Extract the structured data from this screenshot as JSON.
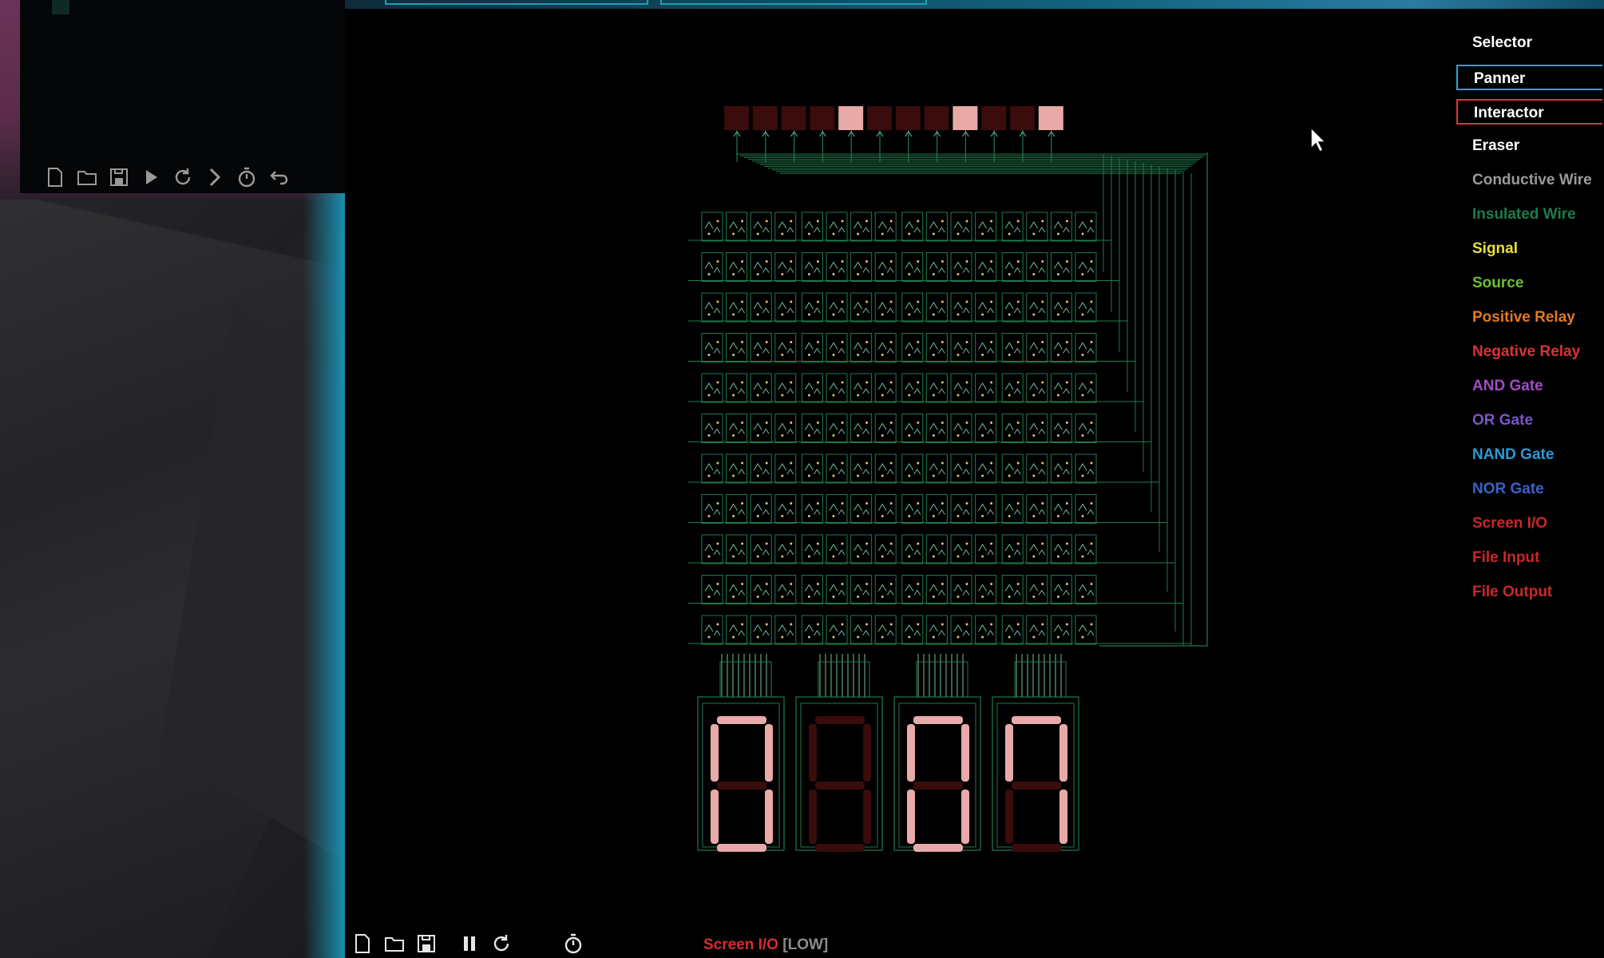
{
  "app": {
    "tools_title": "Tools",
    "tools": [
      {
        "label": "Selector",
        "color": "#ffffff",
        "state": "normal"
      },
      {
        "label": "Panner",
        "color": "#ffffff",
        "state": "hovered"
      },
      {
        "label": "Interactor",
        "color": "#ffffff",
        "state": "active"
      },
      {
        "label": "Eraser",
        "color": "#ffffff",
        "state": "normal"
      },
      {
        "label": "Conductive Wire",
        "color": "#9a9a9a",
        "state": "normal"
      },
      {
        "label": "Insulated Wire",
        "color": "#1f7a4d",
        "state": "normal"
      },
      {
        "label": "Signal",
        "color": "#e8e03a",
        "state": "normal"
      },
      {
        "label": "Source",
        "color": "#6cbf3a",
        "state": "normal"
      },
      {
        "label": "Positive Relay",
        "color": "#e07a22",
        "state": "normal"
      },
      {
        "label": "Negative Relay",
        "color": "#d63535",
        "state": "normal"
      },
      {
        "label": "AND Gate",
        "color": "#a24cc2",
        "state": "normal"
      },
      {
        "label": "OR Gate",
        "color": "#7c55c8",
        "state": "normal"
      },
      {
        "label": "NAND Gate",
        "color": "#2d9ad6",
        "state": "normal"
      },
      {
        "label": "NOR Gate",
        "color": "#3a62c9",
        "state": "normal"
      },
      {
        "label": "Screen I/O",
        "color": "#c82828",
        "state": "normal"
      },
      {
        "label": "File Input",
        "color": "#c82828",
        "state": "normal"
      },
      {
        "label": "File Output",
        "color": "#c82828",
        "state": "normal"
      }
    ]
  },
  "status": {
    "mode": "Screen I/O",
    "level": "[LOW]"
  },
  "toolbar_small": [
    "new-file-icon",
    "open-folder-icon",
    "save-icon",
    "play-icon",
    "reload-icon",
    "step-icon",
    "timer-icon",
    "undo-icon"
  ],
  "toolbar_bottom": [
    "new-file-icon",
    "open-folder-icon",
    "save-icon",
    "pause-icon",
    "reload-icon",
    "timer-icon"
  ],
  "circuit": {
    "input_bits": [
      0,
      0,
      0,
      0,
      1,
      0,
      0,
      0,
      1,
      0,
      0,
      1
    ],
    "display_digits": [
      {
        "segments_on": [
          "a",
          "b",
          "c",
          "d",
          "e",
          "f"
        ]
      },
      {
        "segments_on": []
      },
      {
        "segments_on": [
          "a",
          "b",
          "c",
          "d",
          "e",
          "f"
        ]
      },
      {
        "segments_on": [
          "a",
          "b",
          "c",
          "f"
        ]
      }
    ],
    "colors": {
      "bit_on": "#e8a9a9",
      "bit_off": "#3a0c0c",
      "seg_on": "#e8a9a9",
      "seg_off": "#3a0c0c",
      "wire_insulated": "#1f7a4d",
      "wire_light": "#6fbf9a",
      "gate_dot": "#d9c27a"
    }
  }
}
